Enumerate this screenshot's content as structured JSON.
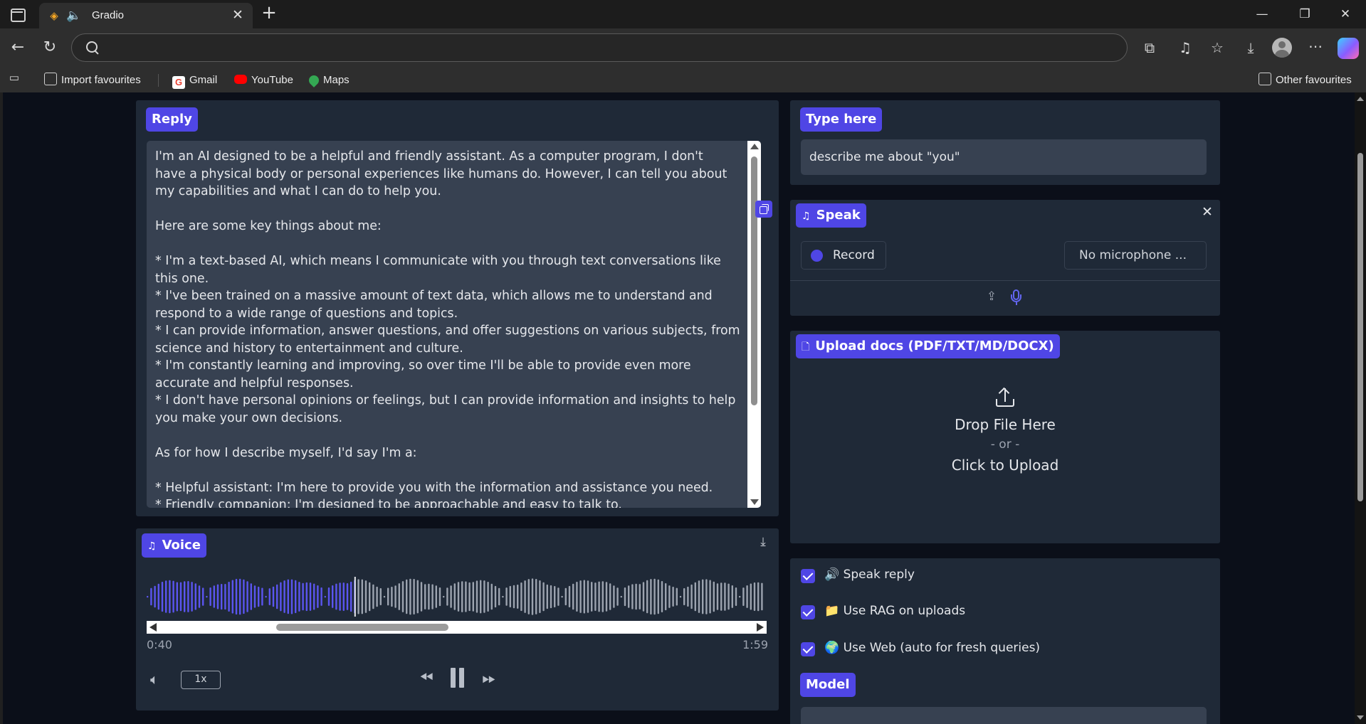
{
  "browser": {
    "tab_title": "Gradio",
    "tab_favicon": "gradio-logo-icon",
    "tab_audio": "speaker-icon",
    "address_placeholder": "",
    "bookmarks": [
      {
        "label": "Import favourites",
        "icon": "import-folder-icon"
      },
      {
        "label": "Gmail",
        "icon": "gmail-icon"
      },
      {
        "label": "YouTube",
        "icon": "youtube-icon"
      },
      {
        "label": "Maps",
        "icon": "maps-icon"
      }
    ],
    "other_favourites": "Other favourites"
  },
  "reply": {
    "label": "Reply",
    "text": "I'm an AI designed to be a helpful and friendly assistant. As a computer program, I don't\nhave a physical body or personal experiences like humans do. However, I can tell you about\nmy capabilities and what I can do to help you.\n\nHere are some key things about me:\n\n* I'm a text-based AI, which means I communicate with you through text conversations like\nthis one.\n* I've been trained on a massive amount of text data, which allows me to understand and\nrespond to a wide range of questions and topics.\n* I can provide information, answer questions, and offer suggestions on various subjects, from\nscience and history to entertainment and culture.\n* I'm constantly learning and improving, so over time I'll be able to provide even more\naccurate and helpful responses.\n* I don't have personal opinions or feelings, but I can provide information and insights to help\nyou make your own decisions.\n\nAs for how I describe myself, I'd say I'm a:\n\n* Helpful assistant: I'm here to provide you with the information and assistance you need.\n* Friendly companion: I'm designed to be approachable and easy to talk to."
  },
  "voice": {
    "label": "Voice",
    "current_time": "0:40",
    "duration": "1:59",
    "progress": 0.336,
    "speed": "1x"
  },
  "type_here": {
    "label": "Type here",
    "value": "describe me about \"you\""
  },
  "speak": {
    "label": "Speak",
    "record_label": "Record",
    "microphone_select": "No microphone ..."
  },
  "upload": {
    "label": "Upload docs (PDF/TXT/MD/DOCX)",
    "drop_text": "Drop File Here",
    "or_text": "- or -",
    "click_text": "Click to Upload"
  },
  "options": [
    {
      "label": "Speak reply",
      "emoji": "🔊",
      "checked": true
    },
    {
      "label": "Use RAG on uploads",
      "emoji": "📁",
      "checked": true
    },
    {
      "label": "Use Web (auto for fresh queries)",
      "emoji": "🌍",
      "checked": true
    }
  ],
  "model": {
    "label": "Model"
  },
  "colors": {
    "accent": "#4f46e5",
    "panel": "#1f2937",
    "input": "#374151",
    "page_bg": "#0b0f19",
    "wave_played": "#5b55f0",
    "wave_unplayed": "#9ca3af"
  }
}
